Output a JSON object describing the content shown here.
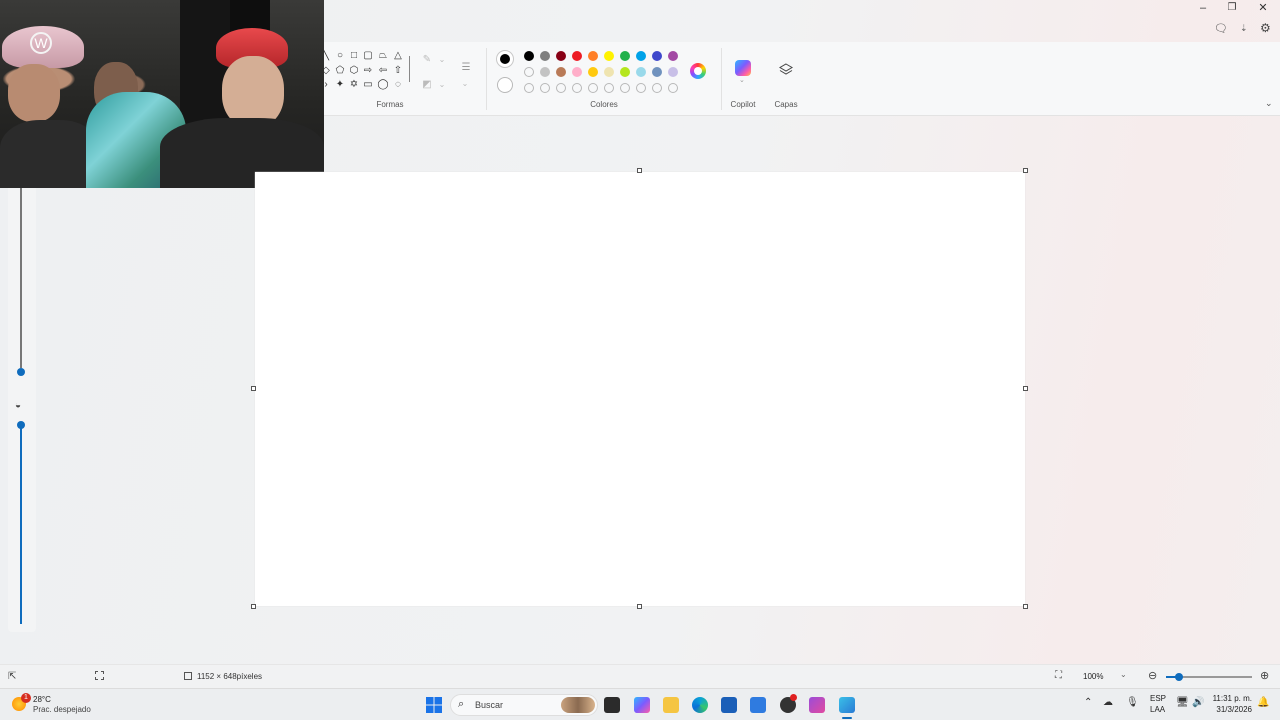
{
  "ribbon": {
    "shapes_label": "Formas",
    "colors_label": "Colores",
    "copilot_label": "Copilot",
    "layers_label": "Capas"
  },
  "palette": {
    "row1": [
      "#000000",
      "#7f7f7f",
      "#880015",
      "#ed1c24",
      "#ff7f27",
      "#fff200",
      "#22b14c",
      "#00a2e8",
      "#3f48cc",
      "#a349a4"
    ],
    "row2": [
      "#c3c3c3",
      "#b97a57",
      "#ffaec9",
      "#ffc90e",
      "#efe4b0",
      "#b5e61d",
      "#99d9ea",
      "#7092be",
      "#c8bfe7"
    ],
    "primary": "#000000",
    "accent": "#0f6cbd"
  },
  "statusbar": {
    "canvas_size": "1152 × 648píxeles",
    "zoom": "100%"
  },
  "taskbar": {
    "weather_temp": "28°C",
    "weather_desc": "Prac. despejado",
    "search_placeholder": "Buscar",
    "lang_top": "ESP",
    "lang_bottom": "LAA",
    "time": "11:31 p. m.",
    "date": "31/3/2026",
    "weather_badge": "1"
  }
}
